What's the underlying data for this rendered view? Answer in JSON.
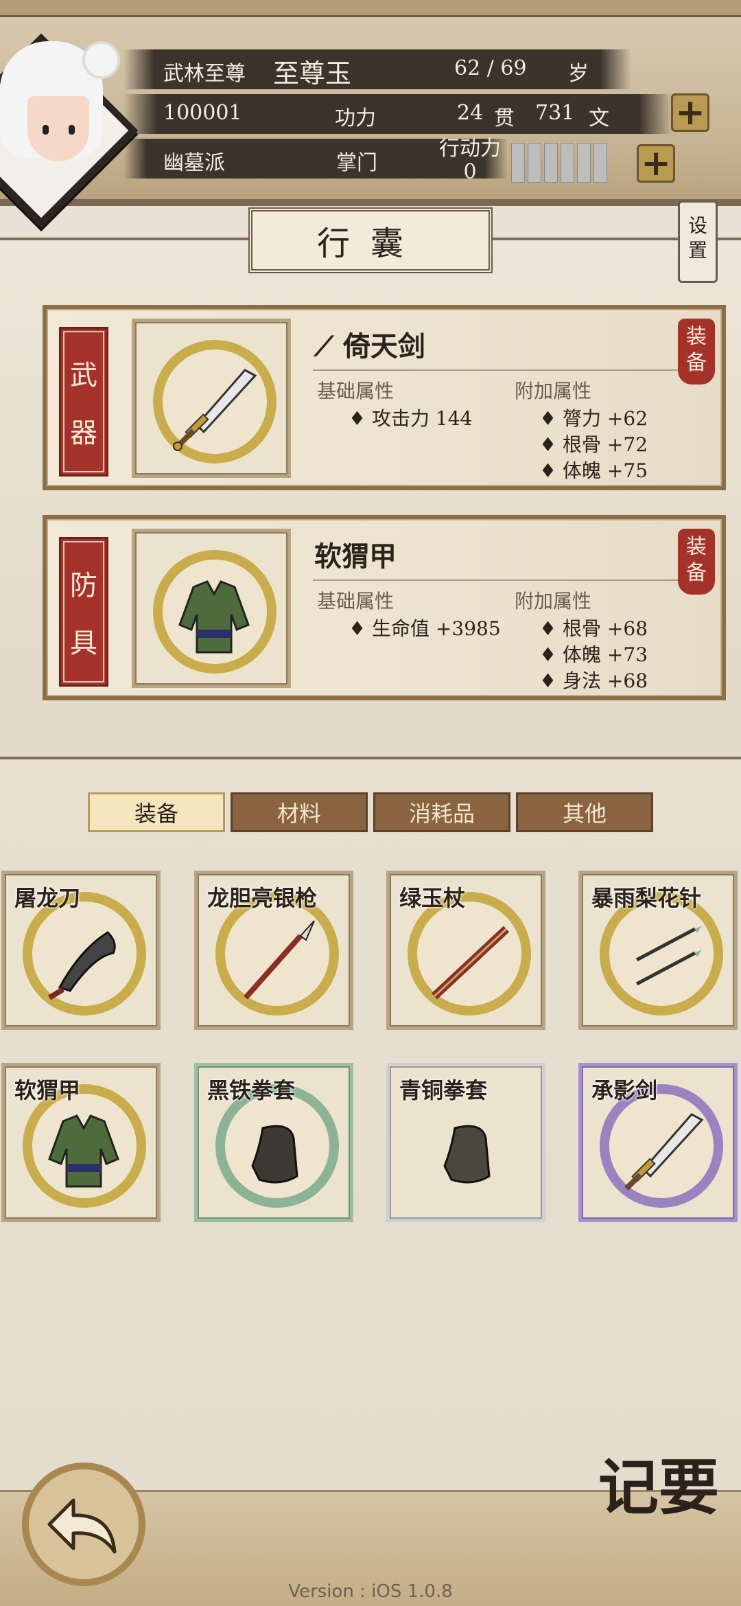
{
  "header": {
    "title_rank": "武林至尊",
    "player_name": "至尊玉",
    "age": "62 / 69",
    "age_unit": "岁",
    "player_id": "100001",
    "skill_label": "功力",
    "money_guan": "24",
    "money_guan_unit": "贯",
    "money_wen": "731",
    "money_wen_unit": "文",
    "sect": "幽墓派",
    "sect_role": "掌门",
    "action_label": "行动力",
    "action_value": "0"
  },
  "page_title": "行囊",
  "settings_label": "设置",
  "equipped": [
    {
      "slot": "武器",
      "name": "倚天剑",
      "base_label": "基础属性",
      "extra_label": "附加属性",
      "base_attrs": [
        "攻击力 144"
      ],
      "extra_attrs": [
        "膂力 +62",
        "根骨 +72",
        "体魄 +75"
      ],
      "tag": "装备"
    },
    {
      "slot": "防具",
      "name": "软猬甲",
      "base_label": "基础属性",
      "extra_label": "附加属性",
      "base_attrs": [
        "生命值 +3985"
      ],
      "extra_attrs": [
        "根骨 +68",
        "体魄 +73",
        "身法 +68"
      ],
      "tag": "装备"
    }
  ],
  "tabs": [
    "装备",
    "材料",
    "消耗品",
    "其他"
  ],
  "active_tab": "装备",
  "inventory": [
    {
      "name": "屠龙刀",
      "rarity": "gold"
    },
    {
      "name": "龙胆亮银枪",
      "rarity": "gold"
    },
    {
      "name": "绿玉杖",
      "rarity": "gold"
    },
    {
      "name": "暴雨梨花针",
      "rarity": "gold"
    },
    {
      "name": "软猬甲",
      "rarity": "gold"
    },
    {
      "name": "黑铁拳套",
      "rarity": "green"
    },
    {
      "name": "青铜拳套",
      "rarity": "white"
    },
    {
      "name": "承影剑",
      "rarity": "purple"
    }
  ],
  "note_button": "记要",
  "version": "Version : iOS 1.0.8",
  "colors": {
    "accent_red": "#a5322a",
    "tab_active": "#f6e6be",
    "tab_inactive": "#8a6440",
    "rarity_gold": "#c9ad4d",
    "rarity_green": "#8cb396",
    "rarity_purple": "#9b82c0"
  }
}
